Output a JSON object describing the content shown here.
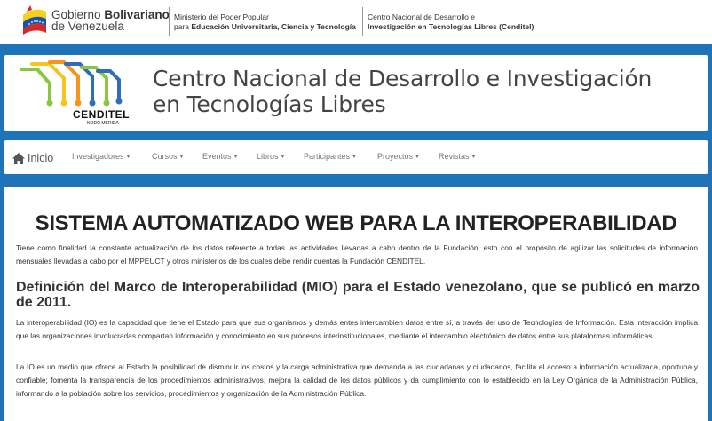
{
  "gov": {
    "name_plain": "Gobierno",
    "name_bold": "Bolivariano",
    "name_line2": "de Venezuela",
    "ministry_line1": "Ministerio del Poder Popular",
    "ministry_line2_prefix": "para ",
    "ministry_line2_bold": "Educación Universitaria, Ciencia y Tecnología",
    "center_line1": "Centro Nacional de Desarrollo e",
    "center_line2": "Investigación en Tecnologías Libres (Cenditel)"
  },
  "banner": {
    "logo_name": "CENDITEL",
    "logo_subtitle": "NODO MÉRIDA",
    "title_line1": "Centro Nacional de Desarrollo e Investigación",
    "title_line2": "en Tecnologías Libres"
  },
  "nav": {
    "home_icon": "home-icon",
    "home_label": "Inicio",
    "items": [
      {
        "label": "Investigadores"
      },
      {
        "label": "Cursos"
      },
      {
        "label": "Eventos"
      },
      {
        "label": "Libros"
      },
      {
        "label": "Participantes"
      },
      {
        "label": "Proyectos"
      },
      {
        "label": "Revistas"
      }
    ]
  },
  "main": {
    "title": "SISTEMA AUTOMATIZADO WEB PARA LA INTEROPERABILIDAD",
    "intro": "Tiene como finalidad la constante actualización de los datos referente a todas las actividades llevadas a cabo dentro de la Fundación, esto con el propósito de agilizar las solicitudes de información mensuales llevadas a cabo por el MPPEUCT y otros ministerios de los cuales debe rendir cuentas la Fundación CENDITEL.",
    "subtitle": "Definición del Marco de Interoperabilidad (MIO) para el Estado venezolano, que se publicó en marzo de 2011.",
    "para2": "La interoperabilidad (IO) es la capacidad que tiene el Estado para que sus organismos y demás entes intercambien datos entre sí, a través del uso de Tecnologías de Información. Esta interacción implica que las organizaciones involucradas compartan información y conocimiento en sus procesos interinstitucionales, mediante el intercambio electrónico de datos entre sus plataformas informáticas.",
    "para3": "La IO es un medio que ofrece al Estado la posibilidad de disminuir los costos y la carga administrativa que demanda a las ciudadanas y ciudadanos, facilita el acceso a información actualizada, oportuna y confiable; fomenta la transparencia de los procedimientos administrativos, mejora la calidad de los datos públicos y da cumplimiento con lo establecido en la Ley Orgánica de la Administración Pública, informando a la población sobre los servicios, procedimientos y organización de la Administración Pública."
  },
  "colors": {
    "page_background": "#1f73b8",
    "logo_green": "#8cc63f",
    "logo_orange": "#f7941d",
    "logo_blue": "#2e6fb7",
    "logo_yellow": "#f4c51c"
  }
}
